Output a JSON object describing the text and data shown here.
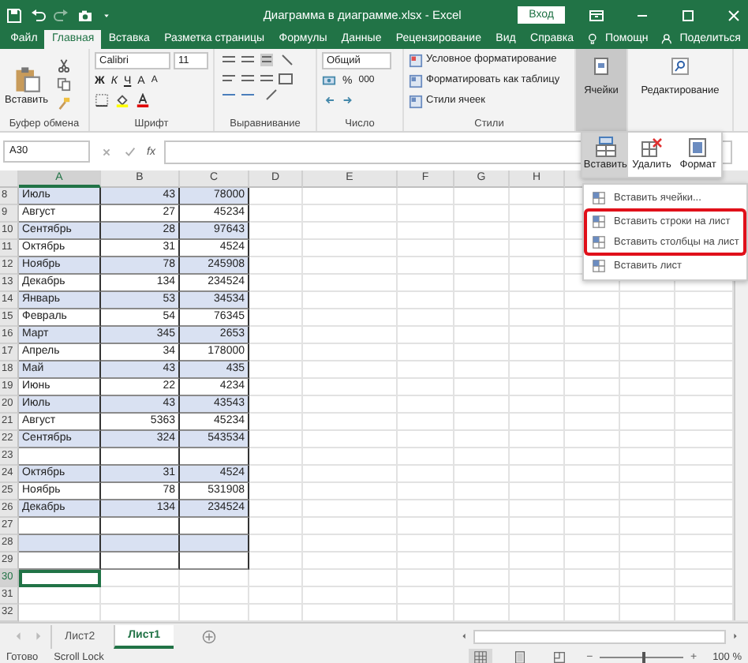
{
  "window": {
    "title": "Диаграмма в диаграмме.xlsx  -  Excel",
    "sign_in": "Вход"
  },
  "tabs": [
    {
      "label": "Файл",
      "selected": false
    },
    {
      "label": "Главная",
      "selected": true
    },
    {
      "label": "Вставка",
      "selected": false
    },
    {
      "label": "Разметка страницы",
      "selected": false
    },
    {
      "label": "Формулы",
      "selected": false
    },
    {
      "label": "Данные",
      "selected": false
    },
    {
      "label": "Рецензирование",
      "selected": false
    },
    {
      "label": "Вид",
      "selected": false
    },
    {
      "label": "Справка",
      "selected": false
    }
  ],
  "help": "Помощн",
  "share": "Поделиться",
  "ribbon": {
    "clipboard": {
      "paste": "Вставить",
      "label": "Буфер обмена"
    },
    "font": {
      "name": "Calibri",
      "size": "11",
      "bold": "Ж",
      "italic": "К",
      "underline": "Ч",
      "grow": "A",
      "shrink": "A",
      "label": "Шрифт"
    },
    "alignment": {
      "label": "Выравнивание"
    },
    "number": {
      "format": "Общий",
      "percent": "%",
      "thousands": "000",
      "label": "Число"
    },
    "styles": {
      "items": [
        "Условное форматирование",
        "Форматировать как таблицу",
        "Стили ячеек"
      ],
      "label": "Стили"
    },
    "cells": {
      "label": "Ячейки",
      "pressed": true
    },
    "editing": {
      "label": "Редактирование"
    }
  },
  "formula_bar": {
    "name_box": "A30",
    "function_label": "fx"
  },
  "columns": [
    "A",
    "B",
    "C",
    "D",
    "E",
    "F",
    "G",
    "H"
  ],
  "rows": [
    {
      "number": "8",
      "kind": "table",
      "banded": true,
      "selected": false,
      "cells": [
        "Июль",
        "43",
        "78000"
      ]
    },
    {
      "number": "9",
      "kind": "table",
      "banded": false,
      "selected": false,
      "cells": [
        "Август",
        "27",
        "45234"
      ]
    },
    {
      "number": "10",
      "kind": "table",
      "banded": true,
      "selected": false,
      "cells": [
        "Сентябрь",
        "28",
        "97643"
      ]
    },
    {
      "number": "11",
      "kind": "table",
      "banded": false,
      "selected": false,
      "cells": [
        "Октябрь",
        "31",
        "4524"
      ]
    },
    {
      "number": "12",
      "kind": "table",
      "banded": true,
      "selected": false,
      "cells": [
        "Ноябрь",
        "78",
        "245908"
      ]
    },
    {
      "number": "13",
      "kind": "table",
      "banded": false,
      "selected": false,
      "cells": [
        "Декабрь",
        "134",
        "234524"
      ]
    },
    {
      "number": "14",
      "kind": "table",
      "banded": true,
      "selected": false,
      "cells": [
        "Январь",
        "53",
        "34534"
      ]
    },
    {
      "number": "15",
      "kind": "table",
      "banded": false,
      "selected": false,
      "cells": [
        "Февраль",
        "54",
        "76345"
      ]
    },
    {
      "number": "16",
      "kind": "table",
      "banded": true,
      "selected": false,
      "cells": [
        "Март",
        "345",
        "2653"
      ]
    },
    {
      "number": "17",
      "kind": "table",
      "banded": false,
      "selected": false,
      "cells": [
        "Апрель",
        "34",
        "178000"
      ]
    },
    {
      "number": "18",
      "kind": "table",
      "banded": true,
      "selected": false,
      "cells": [
        "Май",
        "43",
        "435"
      ]
    },
    {
      "number": "19",
      "kind": "table",
      "banded": false,
      "selected": false,
      "cells": [
        "Июнь",
        "22",
        "4234"
      ]
    },
    {
      "number": "20",
      "kind": "table",
      "banded": true,
      "selected": false,
      "cells": [
        "Июль",
        "43",
        "43543"
      ]
    },
    {
      "number": "21",
      "kind": "table",
      "banded": false,
      "selected": false,
      "cells": [
        "Август",
        "5363",
        "45234"
      ]
    },
    {
      "number": "22",
      "kind": "table",
      "banded": true,
      "selected": false,
      "cells": [
        "Сентябрь",
        "324",
        "543534"
      ]
    },
    {
      "number": "23",
      "kind": "table",
      "banded": false,
      "selected": false
    },
    {
      "number": "24",
      "kind": "table",
      "banded": true,
      "selected": false,
      "cells": [
        "Октябрь",
        "31",
        "4524"
      ]
    },
    {
      "number": "25",
      "kind": "table",
      "banded": false,
      "selected": false,
      "cells": [
        "Ноябрь",
        "78",
        "531908"
      ]
    },
    {
      "number": "26",
      "kind": "table",
      "banded": true,
      "selected": false,
      "cells": [
        "Декабрь",
        "134",
        "234524"
      ]
    },
    {
      "number": "27",
      "kind": "table",
      "banded": false,
      "selected": false
    },
    {
      "number": "28",
      "kind": "table",
      "banded": true,
      "selected": false
    },
    {
      "number": "29",
      "kind": "table",
      "banded": false,
      "selected": false
    },
    {
      "number": "30",
      "kind": "plain",
      "selected": true
    },
    {
      "number": "31",
      "kind": "plain",
      "selected": false
    },
    {
      "number": "32",
      "kind": "plain",
      "selected": false
    }
  ],
  "cells_dropdown": {
    "buttons": [
      {
        "label": "Вставить",
        "selected": true
      },
      {
        "label": "Удалить",
        "selected": false
      },
      {
        "label": "Формат",
        "selected": false
      }
    ],
    "menu": [
      {
        "label": "Вставить ячейки...",
        "highlighted": false
      },
      {
        "label": "Вставить строки на лист",
        "highlighted": true
      },
      {
        "label": "Вставить столбцы на лист",
        "highlighted": true
      },
      {
        "label": "Вставить лист",
        "highlighted": false
      }
    ]
  },
  "sheets": [
    {
      "label": "Лист2",
      "selected": false
    },
    {
      "label": "Лист1",
      "selected": true
    }
  ],
  "status_bar": {
    "ready": "Готово",
    "scroll_lock": "Scroll Lock",
    "zoom": "100 %",
    "zoom_slider": {
      "minus": "−",
      "plus": "+",
      "level": 0.5
    }
  }
}
